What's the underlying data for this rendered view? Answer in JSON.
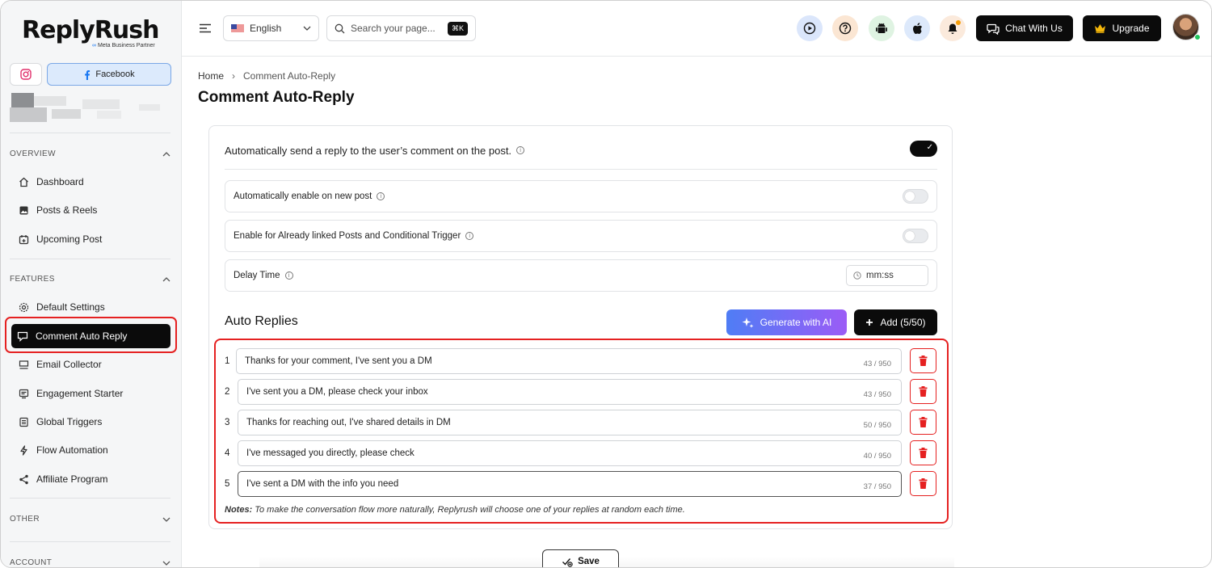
{
  "brand": {
    "name": "ReplyRush",
    "partner": "Meta Business Partner"
  },
  "sidebar": {
    "platforms": {
      "facebook_label": "Facebook"
    },
    "overview_label": "OVERVIEW",
    "overview_items": [
      {
        "label": "Dashboard",
        "icon": "home-icon"
      },
      {
        "label": "Posts & Reels",
        "icon": "image-icon"
      },
      {
        "label": "Upcoming Post",
        "icon": "calendar-plus-icon"
      }
    ],
    "features_label": "FEATURES",
    "features_items": [
      {
        "label": "Default Settings",
        "icon": "gear-icon"
      },
      {
        "label": "Comment Auto Reply",
        "icon": "comment-reply-icon",
        "active": true
      },
      {
        "label": "Email Collector",
        "icon": "email-collector-icon"
      },
      {
        "label": "Engagement Starter",
        "icon": "engagement-icon"
      },
      {
        "label": "Global Triggers",
        "icon": "list-icon"
      },
      {
        "label": "Flow Automation",
        "icon": "bolt-icon"
      },
      {
        "label": "Affiliate Program",
        "icon": "share-icon"
      }
    ],
    "other_label": "OTHER",
    "account_label": "ACCOUNT"
  },
  "topbar": {
    "language": "English",
    "search_placeholder": "Search your page...",
    "search_shortcut": "⌘K",
    "chat_label": "Chat With Us",
    "upgrade_label": "Upgrade"
  },
  "breadcrumb": {
    "home": "Home",
    "current": "Comment Auto-Reply"
  },
  "page": {
    "title": "Comment Auto-Reply"
  },
  "settings": {
    "main_toggle_label": "Automatically send a reply to the user’s comment on the post.",
    "main_toggle_on": true,
    "auto_enable_label": "Automatically enable on new post",
    "already_linked_label": "Enable for Already linked Posts and Conditional Trigger",
    "delay_label": "Delay Time",
    "delay_placeholder": "mm:ss"
  },
  "auto_replies": {
    "title": "Auto Replies",
    "generate_label": "Generate with AI",
    "add_label": "Add (5/50)",
    "items": [
      {
        "num": "1",
        "text": "Thanks for your comment, I've sent you a DM",
        "count": "43 / 950"
      },
      {
        "num": "2",
        "text": "I've sent you a DM, please check your inbox",
        "count": "43 / 950"
      },
      {
        "num": "3",
        "text": "Thanks for reaching out, I've shared details in DM",
        "count": "50 / 950"
      },
      {
        "num": "4",
        "text": "I've messaged you directly, please check",
        "count": "40 / 950"
      },
      {
        "num": "5",
        "text": "I've sent a DM with the info you need",
        "count": "37 / 950"
      }
    ],
    "notes_label": "Notes:",
    "notes_text": "To make the conversation flow more naturally, Replyrush will choose one of your replies at random each time."
  },
  "save_label": "Save",
  "colors": {
    "accent_red": "#e52121",
    "dark": "#0b0b0b",
    "ai_gradient_start": "#4f7df5",
    "ai_gradient_end": "#9b5cf6"
  }
}
